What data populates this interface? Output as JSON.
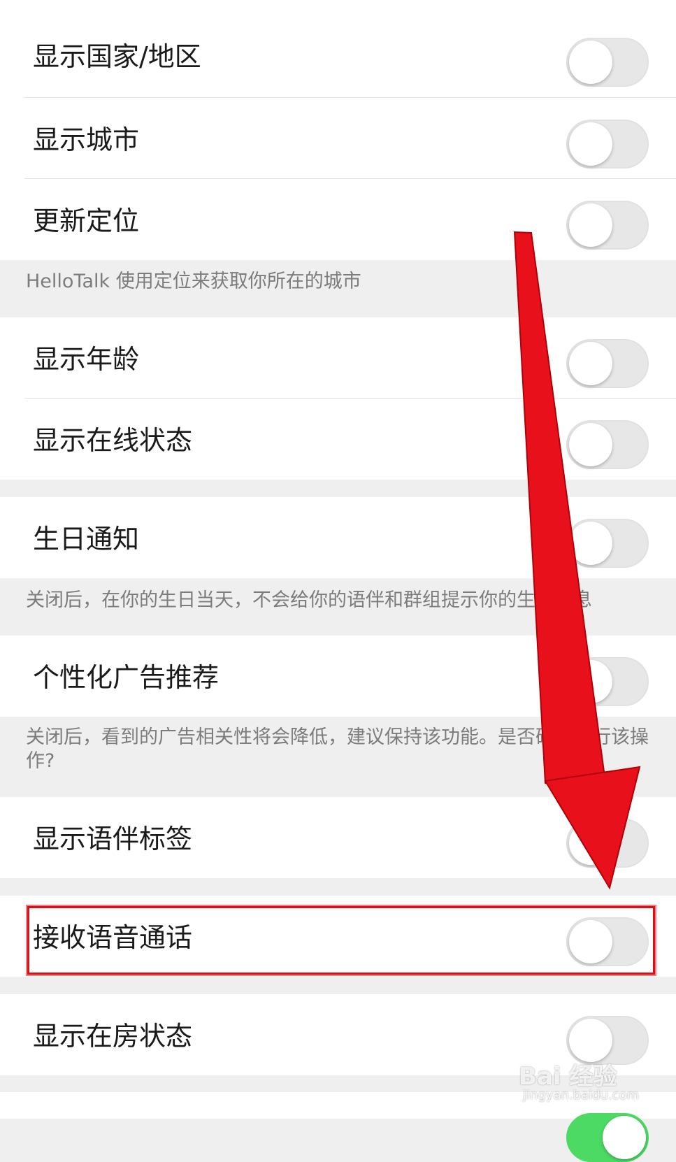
{
  "settings": {
    "rows": [
      {
        "label": "显示国家/地区",
        "on": false
      },
      {
        "label": "显示城市",
        "on": false
      },
      {
        "label": "更新定位",
        "on": false
      },
      {
        "label": "显示年龄",
        "on": false
      },
      {
        "label": "显示在线状态",
        "on": false
      },
      {
        "label": "生日通知",
        "on": false
      },
      {
        "label": "个性化广告推荐",
        "on": false
      },
      {
        "label": "显示语伴标签",
        "on": false
      },
      {
        "label": "接收语音通话",
        "on": false
      },
      {
        "label": "显示在房状态",
        "on": false
      }
    ],
    "notes": {
      "location": "HelloTalk 使用定位来获取你所在的城市",
      "birthday": "关闭后，在你的生日当天，不会给你的语伴和群组提示你的生日信息",
      "ads": "关闭后，看到的广告相关性将会降低，建议保持该功能。是否确认执行该操作?"
    }
  },
  "watermark": {
    "brand": "Bai 经验",
    "url": "jingyan.baidu.com"
  },
  "colors": {
    "arrow": "#e8101a",
    "highlight": "#d8101a",
    "toggle_off": "#e7e7e7",
    "toggle_on": "#4cd964"
  }
}
